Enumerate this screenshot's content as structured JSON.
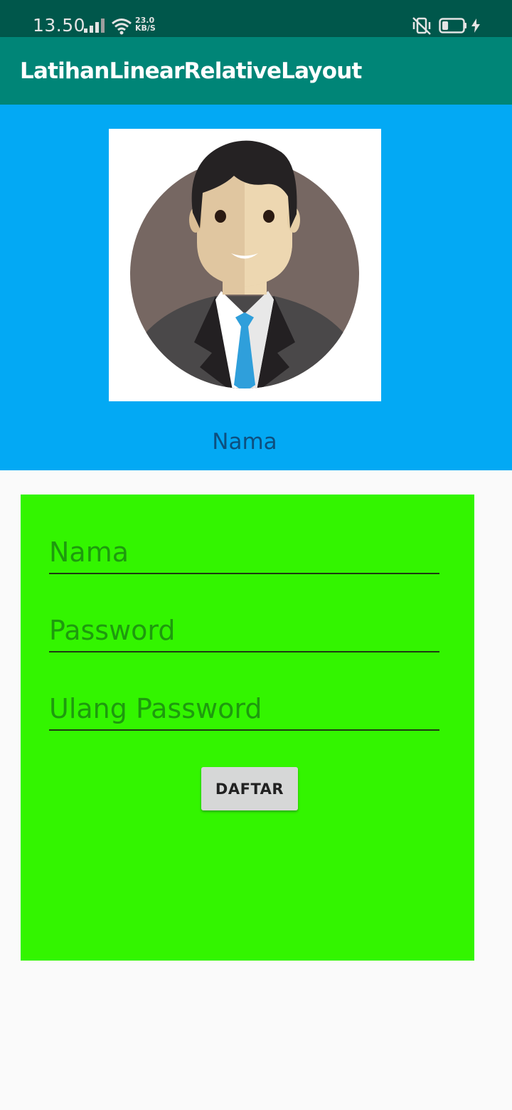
{
  "status_bar": {
    "time": "13.50",
    "net_speed_value": "23.0",
    "net_speed_unit": "KB/S",
    "icons": [
      "signal-icon",
      "wifi-icon",
      "vibrate-off-icon",
      "battery-icon",
      "charging-icon"
    ],
    "battery_level": 0.3
  },
  "app_bar": {
    "title": "LatihanLinearRelativeLayout"
  },
  "header": {
    "avatar_icon": "user-avatar-icon",
    "name_label": "Nama"
  },
  "form": {
    "nama_placeholder": "Nama",
    "password_placeholder": "Password",
    "ulang_password_placeholder": "Ulang Password",
    "submit_label": "DAFTAR"
  },
  "colors": {
    "status_bar": "#00574B",
    "app_bar": "#008577",
    "header_bg": "#03A9F4",
    "form_bg": "#33F500",
    "button_bg": "#D6D7D7"
  }
}
